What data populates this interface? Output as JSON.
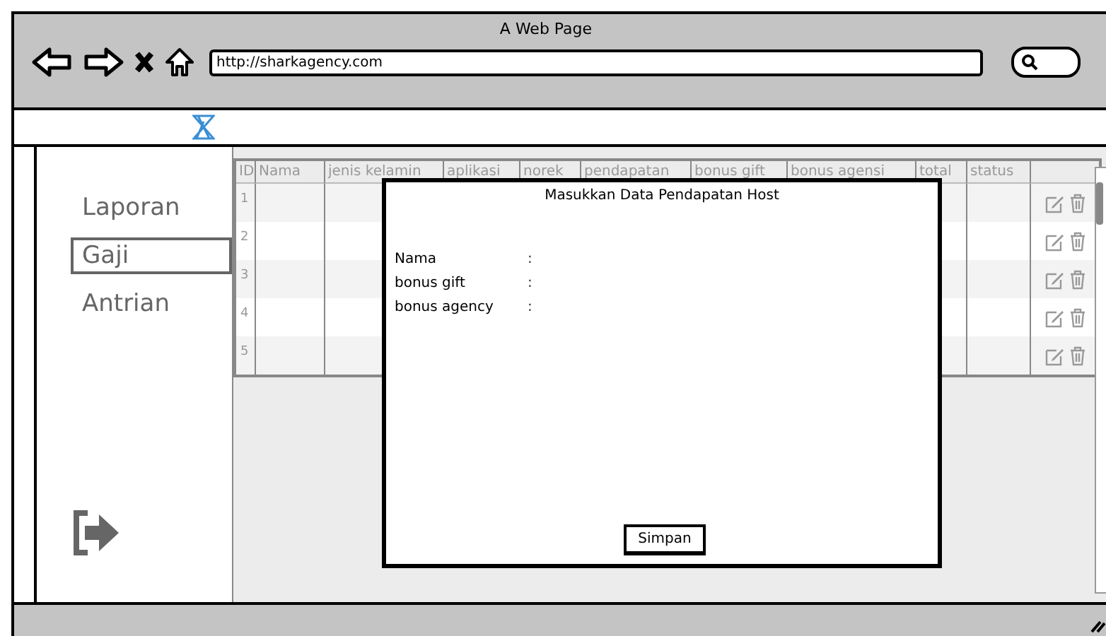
{
  "window": {
    "title": "A Web Page",
    "url": "http://sharkagency.com"
  },
  "sidebar": {
    "items": [
      {
        "label": "Laporan",
        "selected": false
      },
      {
        "label": "Gaji",
        "selected": true
      },
      {
        "label": "Antrian",
        "selected": false
      }
    ]
  },
  "table": {
    "columns": [
      "ID",
      "Nama",
      "jenis kelamin",
      "aplikasi",
      "norek",
      "pendapatan",
      "bonus gift",
      "bonus agensi",
      "total",
      "status"
    ],
    "rows": [
      {
        "id": "1"
      },
      {
        "id": "2"
      },
      {
        "id": "3"
      },
      {
        "id": "4"
      },
      {
        "id": "5"
      }
    ]
  },
  "dialog": {
    "title": "Masukkan Data Pendapatan Host",
    "fields": [
      {
        "label": "Nama",
        "separator": ":"
      },
      {
        "label": "bonus gift",
        "separator": ":"
      },
      {
        "label": "bonus agency",
        "separator": ":"
      }
    ],
    "button": "Simpan"
  }
}
